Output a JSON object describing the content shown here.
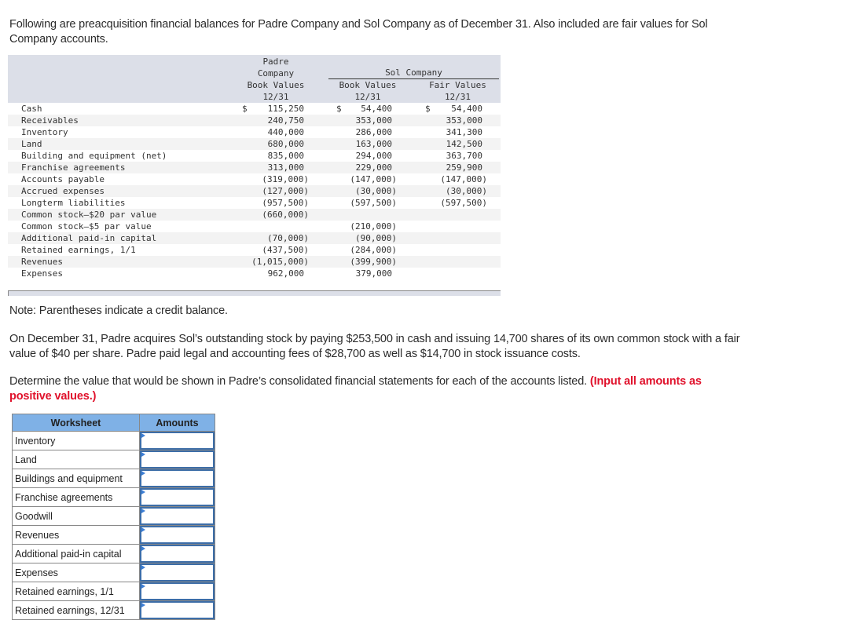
{
  "intro": "Following are preacquisition financial balances for Padre Company and Sol Company as of December 31. Also included are fair values for Sol Company accounts.",
  "balance_table": {
    "headers": {
      "padre_lines": [
        "Padre",
        "Company",
        "Book Values",
        "12/31"
      ],
      "sol_group": "Sol Company",
      "sol_book_lines": [
        "Book Values",
        "12/31"
      ],
      "sol_fair_lines": [
        "Fair Values",
        "12/31"
      ]
    },
    "currency_symbol": "$",
    "rows": [
      {
        "account": "Cash",
        "padre": "115,250",
        "sol_book": "54,400",
        "sol_fair": "54,400",
        "dollar": true
      },
      {
        "account": "Receivables",
        "padre": "240,750",
        "sol_book": "353,000",
        "sol_fair": "353,000"
      },
      {
        "account": "Inventory",
        "padre": "440,000",
        "sol_book": "286,000",
        "sol_fair": "341,300"
      },
      {
        "account": "Land",
        "padre": "680,000",
        "sol_book": "163,000",
        "sol_fair": "142,500"
      },
      {
        "account": "Building and equipment (net)",
        "padre": "835,000",
        "sol_book": "294,000",
        "sol_fair": "363,700"
      },
      {
        "account": "Franchise agreements",
        "padre": "313,000",
        "sol_book": "229,000",
        "sol_fair": "259,900"
      },
      {
        "account": "Accounts payable",
        "padre": "(319,000)",
        "sol_book": "(147,000)",
        "sol_fair": "(147,000)"
      },
      {
        "account": "Accrued expenses",
        "padre": "(127,000)",
        "sol_book": "(30,000)",
        "sol_fair": "(30,000)"
      },
      {
        "account": "Longterm liabilities",
        "padre": "(957,500)",
        "sol_book": "(597,500)",
        "sol_fair": "(597,500)"
      },
      {
        "account": "Common stock—$20 par value",
        "padre": "(660,000)",
        "sol_book": "",
        "sol_fair": ""
      },
      {
        "account": "Common stock—$5 par value",
        "padre": "",
        "sol_book": "(210,000)",
        "sol_fair": ""
      },
      {
        "account": "Additional paid-in capital",
        "padre": "(70,000)",
        "sol_book": "(90,000)",
        "sol_fair": ""
      },
      {
        "account": "Retained earnings, 1/1",
        "padre": "(437,500)",
        "sol_book": "(284,000)",
        "sol_fair": ""
      },
      {
        "account": "Revenues",
        "padre": "(1,015,000)",
        "sol_book": "(399,900)",
        "sol_fair": ""
      },
      {
        "account": "Expenses",
        "padre": "962,000",
        "sol_book": "379,000",
        "sol_fair": ""
      }
    ]
  },
  "note": "Note: Parentheses indicate a credit balance.",
  "scenario": "On December 31, Padre acquires Sol’s outstanding stock by paying $253,500 in cash and issuing 14,700 shares of its own common stock with a fair value of $40 per share. Padre paid legal and accounting fees of $28,700 as well as $14,700 in stock issuance costs.",
  "instruction": "Determine the value that would be shown in Padre’s consolidated financial statements for each of the accounts listed.",
  "instruction_emphasis": "(Input all amounts as positive values.)",
  "worksheet": {
    "header_label": "Worksheet",
    "header_amounts": "Amounts",
    "rows": [
      {
        "label": "Inventory",
        "value": ""
      },
      {
        "label": "Land",
        "value": ""
      },
      {
        "label": "Buildings and equipment",
        "value": ""
      },
      {
        "label": "Franchise agreements",
        "value": ""
      },
      {
        "label": "Goodwill",
        "value": ""
      },
      {
        "label": "Revenues",
        "value": ""
      },
      {
        "label": "Additional paid-in capital",
        "value": ""
      },
      {
        "label": "Expenses",
        "value": ""
      },
      {
        "label": "Retained earnings, 1/1",
        "value": ""
      },
      {
        "label": "Retained earnings, 12/31",
        "value": ""
      }
    ]
  },
  "colors": {
    "table_header_bg": "#dcdfe8",
    "worksheet_header_bg": "#7fb1e6",
    "input_border": "#3d6ea8",
    "emphasis_red": "#e0112b"
  }
}
